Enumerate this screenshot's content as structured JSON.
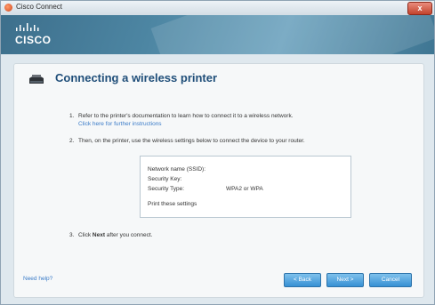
{
  "window": {
    "title": "Cisco Connect",
    "close_label": "x"
  },
  "header": {
    "brand": "CISCO"
  },
  "main": {
    "heading": "Connecting a wireless printer",
    "steps": [
      {
        "number": "1.",
        "text": "Refer to the printer's documentation to learn how to connect it to a wireless network.",
        "link": "Click here for further instructions"
      },
      {
        "number": "2.",
        "text": "Then, on the printer, use the wireless settings below to connect the device to your router."
      },
      {
        "number": "3.",
        "text_prefix": "Click ",
        "text_bold": "Next",
        "text_suffix": " after you connect."
      }
    ],
    "settings": {
      "network_name_label": "Network name (SSID):",
      "security_key_label": "Security Key:",
      "security_type_label": "Security Type:",
      "security_type_value": "WPA2 or WPA",
      "print_link": "Print these settings"
    }
  },
  "footer": {
    "help_link": "Need help?",
    "back_label": "< Back",
    "next_label": "Next >",
    "cancel_label": "Cancel"
  },
  "colors": {
    "header_bg": "#4d86a3",
    "heading": "#1f4e79",
    "link": "#3a7bc8",
    "button": "#3690d4"
  },
  "icons": [
    "app-icon",
    "close-icon",
    "cisco-logo",
    "printer-icon"
  ]
}
